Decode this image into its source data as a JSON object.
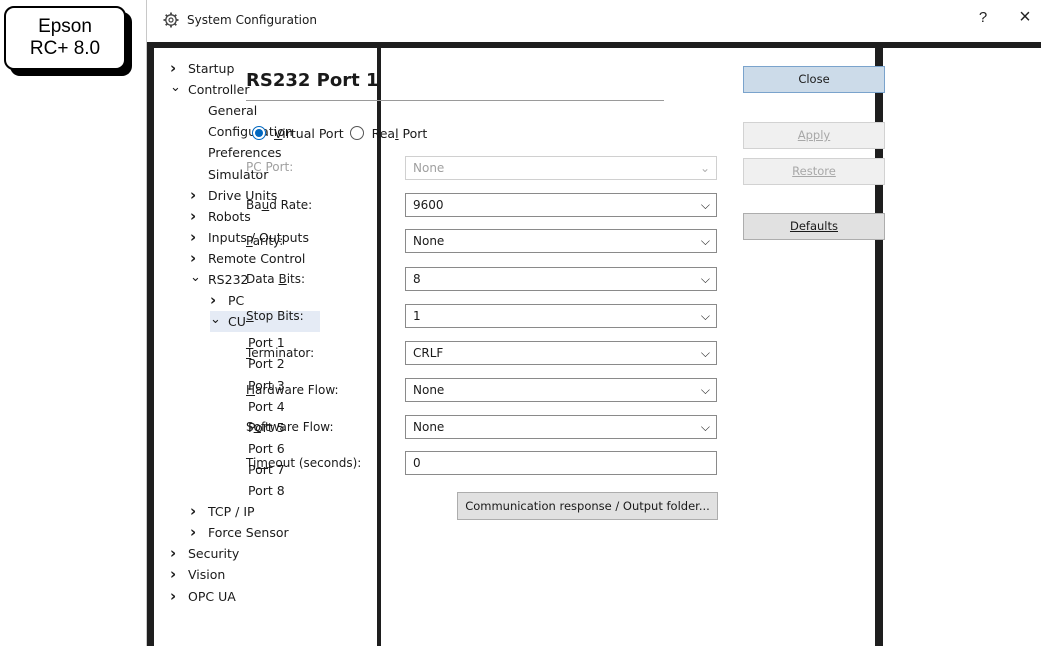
{
  "badge": {
    "line1": "Epson",
    "line2": "RC+ 8.0"
  },
  "window": {
    "title": "System Configuration",
    "help": "?",
    "close": "×"
  },
  "tree": [
    {
      "label": "Startup",
      "chevron": "›"
    },
    {
      "label": "Controller",
      "chevron": "⌄"
    },
    {
      "label": "General",
      "chevron": ""
    },
    {
      "label": "Configuration",
      "chevron": ""
    },
    {
      "label": "Preferences",
      "chevron": ""
    },
    {
      "label": "Simulator",
      "chevron": ""
    },
    {
      "label": "Drive Units",
      "chevron": "›"
    },
    {
      "label": "Robots",
      "chevron": "›"
    },
    {
      "label": "Inputs / Outputs",
      "chevron": "›"
    },
    {
      "label": "Remote Control",
      "chevron": "›"
    },
    {
      "label": "RS232",
      "chevron": "⌄"
    },
    {
      "label": "PC",
      "chevron": "›"
    },
    {
      "label": "CU",
      "chevron": "⌄"
    },
    {
      "label": "Port 1",
      "chevron": ""
    },
    {
      "label": "Port 2",
      "chevron": ""
    },
    {
      "label": "Port 3",
      "chevron": ""
    },
    {
      "label": "Port 4",
      "chevron": ""
    },
    {
      "label": "Port 5",
      "chevron": ""
    },
    {
      "label": "Port 6",
      "chevron": ""
    },
    {
      "label": "Port 7",
      "chevron": ""
    },
    {
      "label": "Port 8",
      "chevron": ""
    },
    {
      "label": "TCP / IP",
      "chevron": "›"
    },
    {
      "label": "Force Sensor",
      "chevron": "›"
    },
    {
      "label": "Security",
      "chevron": "›"
    },
    {
      "label": "Vision",
      "chevron": "›"
    },
    {
      "label": "OPC UA",
      "chevron": "›"
    }
  ],
  "content": {
    "title": "RS232 Port 1",
    "radio": {
      "virtual": {
        "pre": "",
        "key": "V",
        "post": "irtual Port",
        "selected": true
      },
      "real": {
        "pre": "Rea",
        "key": "l",
        "post": " Port",
        "selected": false
      }
    },
    "fields": {
      "pc_port": {
        "pre": "P",
        "key": "C",
        "post": " Port:",
        "value": "None"
      },
      "baud_rate": {
        "pre": "Ba",
        "key": "u",
        "post": "d Rate:",
        "value": "9600"
      },
      "parity": {
        "pre": "",
        "key": "P",
        "post": "arity:",
        "value": "None"
      },
      "data_bits": {
        "pre": "Data ",
        "key": "B",
        "post": "its:",
        "value": "8"
      },
      "stop_bits": {
        "pre": "",
        "key": "S",
        "post": "top Bits:",
        "value": "1"
      },
      "terminator": {
        "pre": "",
        "key": "T",
        "post": "erminator:",
        "value": "CRLF"
      },
      "hardware_flow": {
        "pre": "",
        "key": "H",
        "post": "ardware Flow:",
        "value": "None"
      },
      "software_flow": {
        "pre": "S",
        "key": "o",
        "post": "ftware Flow:",
        "value": "None"
      },
      "timeout": {
        "pre": "Ti",
        "key": "m",
        "post": "eout (seconds):",
        "value": "0"
      }
    },
    "comm_button": "Communication response / Output folder..."
  },
  "buttons": {
    "close": "Close",
    "apply": "Apply",
    "restore": "Restore",
    "defaults": "Defaults"
  }
}
